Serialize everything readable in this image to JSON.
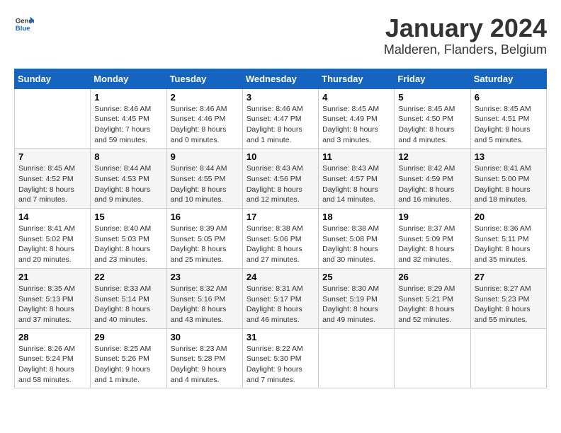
{
  "header": {
    "logo_general": "General",
    "logo_blue": "Blue",
    "main_title": "January 2024",
    "subtitle": "Malderen, Flanders, Belgium"
  },
  "weekdays": [
    "Sunday",
    "Monday",
    "Tuesday",
    "Wednesday",
    "Thursday",
    "Friday",
    "Saturday"
  ],
  "weeks": [
    [
      {
        "day": "",
        "info": ""
      },
      {
        "day": "1",
        "info": "Sunrise: 8:46 AM\nSunset: 4:45 PM\nDaylight: 7 hours\nand 59 minutes."
      },
      {
        "day": "2",
        "info": "Sunrise: 8:46 AM\nSunset: 4:46 PM\nDaylight: 8 hours\nand 0 minutes."
      },
      {
        "day": "3",
        "info": "Sunrise: 8:46 AM\nSunset: 4:47 PM\nDaylight: 8 hours\nand 1 minute."
      },
      {
        "day": "4",
        "info": "Sunrise: 8:45 AM\nSunset: 4:49 PM\nDaylight: 8 hours\nand 3 minutes."
      },
      {
        "day": "5",
        "info": "Sunrise: 8:45 AM\nSunset: 4:50 PM\nDaylight: 8 hours\nand 4 minutes."
      },
      {
        "day": "6",
        "info": "Sunrise: 8:45 AM\nSunset: 4:51 PM\nDaylight: 8 hours\nand 5 minutes."
      }
    ],
    [
      {
        "day": "7",
        "info": "Sunrise: 8:45 AM\nSunset: 4:52 PM\nDaylight: 8 hours\nand 7 minutes."
      },
      {
        "day": "8",
        "info": "Sunrise: 8:44 AM\nSunset: 4:53 PM\nDaylight: 8 hours\nand 9 minutes."
      },
      {
        "day": "9",
        "info": "Sunrise: 8:44 AM\nSunset: 4:55 PM\nDaylight: 8 hours\nand 10 minutes."
      },
      {
        "day": "10",
        "info": "Sunrise: 8:43 AM\nSunset: 4:56 PM\nDaylight: 8 hours\nand 12 minutes."
      },
      {
        "day": "11",
        "info": "Sunrise: 8:43 AM\nSunset: 4:57 PM\nDaylight: 8 hours\nand 14 minutes."
      },
      {
        "day": "12",
        "info": "Sunrise: 8:42 AM\nSunset: 4:59 PM\nDaylight: 8 hours\nand 16 minutes."
      },
      {
        "day": "13",
        "info": "Sunrise: 8:41 AM\nSunset: 5:00 PM\nDaylight: 8 hours\nand 18 minutes."
      }
    ],
    [
      {
        "day": "14",
        "info": "Sunrise: 8:41 AM\nSunset: 5:02 PM\nDaylight: 8 hours\nand 20 minutes."
      },
      {
        "day": "15",
        "info": "Sunrise: 8:40 AM\nSunset: 5:03 PM\nDaylight: 8 hours\nand 23 minutes."
      },
      {
        "day": "16",
        "info": "Sunrise: 8:39 AM\nSunset: 5:05 PM\nDaylight: 8 hours\nand 25 minutes."
      },
      {
        "day": "17",
        "info": "Sunrise: 8:38 AM\nSunset: 5:06 PM\nDaylight: 8 hours\nand 27 minutes."
      },
      {
        "day": "18",
        "info": "Sunrise: 8:38 AM\nSunset: 5:08 PM\nDaylight: 8 hours\nand 30 minutes."
      },
      {
        "day": "19",
        "info": "Sunrise: 8:37 AM\nSunset: 5:09 PM\nDaylight: 8 hours\nand 32 minutes."
      },
      {
        "day": "20",
        "info": "Sunrise: 8:36 AM\nSunset: 5:11 PM\nDaylight: 8 hours\nand 35 minutes."
      }
    ],
    [
      {
        "day": "21",
        "info": "Sunrise: 8:35 AM\nSunset: 5:13 PM\nDaylight: 8 hours\nand 37 minutes."
      },
      {
        "day": "22",
        "info": "Sunrise: 8:33 AM\nSunset: 5:14 PM\nDaylight: 8 hours\nand 40 minutes."
      },
      {
        "day": "23",
        "info": "Sunrise: 8:32 AM\nSunset: 5:16 PM\nDaylight: 8 hours\nand 43 minutes."
      },
      {
        "day": "24",
        "info": "Sunrise: 8:31 AM\nSunset: 5:17 PM\nDaylight: 8 hours\nand 46 minutes."
      },
      {
        "day": "25",
        "info": "Sunrise: 8:30 AM\nSunset: 5:19 PM\nDaylight: 8 hours\nand 49 minutes."
      },
      {
        "day": "26",
        "info": "Sunrise: 8:29 AM\nSunset: 5:21 PM\nDaylight: 8 hours\nand 52 minutes."
      },
      {
        "day": "27",
        "info": "Sunrise: 8:27 AM\nSunset: 5:23 PM\nDaylight: 8 hours\nand 55 minutes."
      }
    ],
    [
      {
        "day": "28",
        "info": "Sunrise: 8:26 AM\nSunset: 5:24 PM\nDaylight: 8 hours\nand 58 minutes."
      },
      {
        "day": "29",
        "info": "Sunrise: 8:25 AM\nSunset: 5:26 PM\nDaylight: 9 hours\nand 1 minute."
      },
      {
        "day": "30",
        "info": "Sunrise: 8:23 AM\nSunset: 5:28 PM\nDaylight: 9 hours\nand 4 minutes."
      },
      {
        "day": "31",
        "info": "Sunrise: 8:22 AM\nSunset: 5:30 PM\nDaylight: 9 hours\nand 7 minutes."
      },
      {
        "day": "",
        "info": ""
      },
      {
        "day": "",
        "info": ""
      },
      {
        "day": "",
        "info": ""
      }
    ]
  ]
}
